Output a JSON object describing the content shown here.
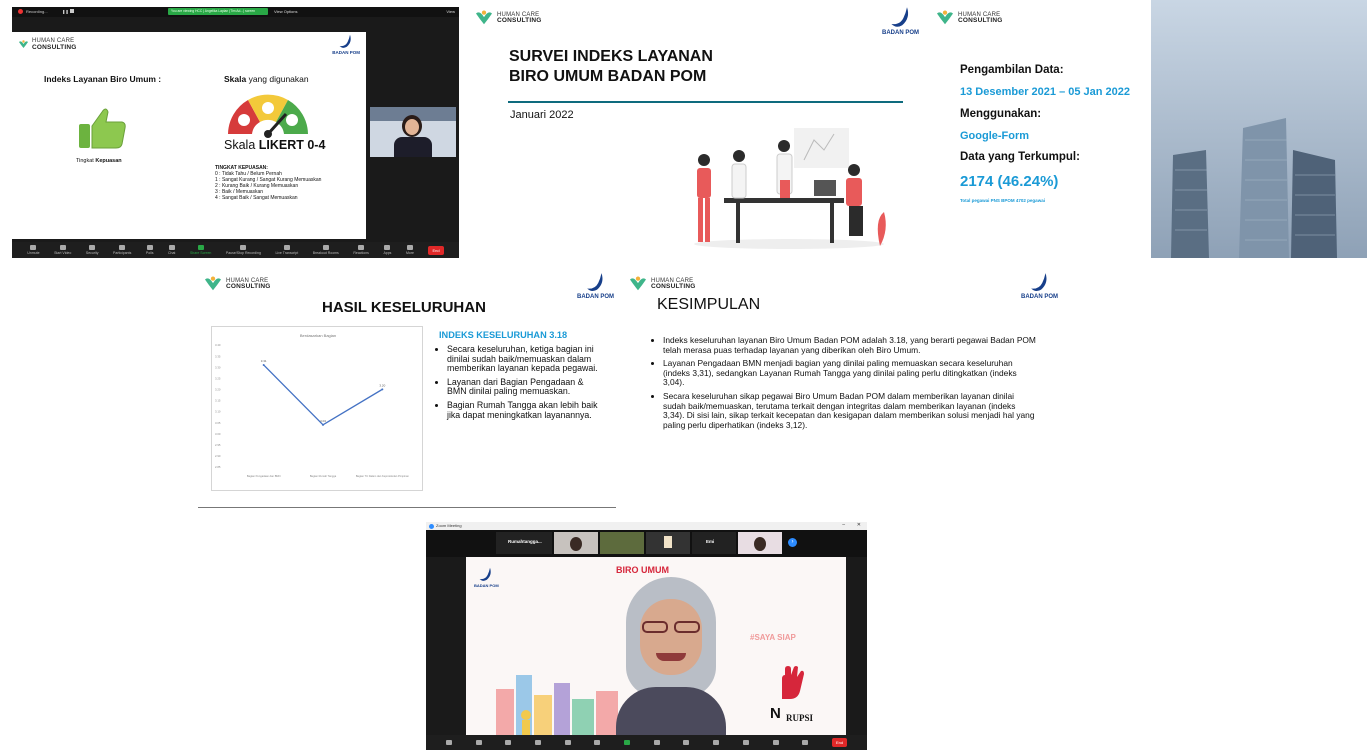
{
  "zoom1": {
    "recording": "Recording...",
    "green_banner": "You are viewing HCC | Angelika Lapian (Tim Ad...) screen",
    "view_options": "View Options",
    "view_btn": "View",
    "slide": {
      "left_title": "Indeks Layanan Biro Umum :",
      "scale_title_bold": "Skala",
      "scale_title_rest": " yang digunakan",
      "likert_prefix": "Skala ",
      "likert_bold": "LIKERT 0-4",
      "satisfaction_label_prefix": "Tingkat ",
      "satisfaction_label_bold": "Kepuasan",
      "levels_title": "TINGKAT KEPUASAN:",
      "levels": [
        "0 : Tidak Tahu / Belum Pernah",
        "1 : Sangat Kurang / Sangat Kurang Memuaskan",
        "2 : Kurang Baik / Kurang Memuaskan",
        "3 : Baik / Memuaskan",
        "4 : Sangat Baik / Sangat Memuaskan"
      ]
    },
    "toolbar": [
      "Unmute",
      "Start Video",
      "Security",
      "Participants",
      "Polls",
      "Chat",
      "Share Screen",
      "Pause/Stop Recording",
      "Live Transcript",
      "Breakout Rooms",
      "Reactions",
      "Apps",
      "More"
    ],
    "end": "End"
  },
  "brand": {
    "hcc_line1": "HUMAN CARE",
    "hcc_line2": "CONSULTING",
    "bpom": "BADAN POM"
  },
  "slide2": {
    "title_line1": "SURVEI INDEKS LAYANAN",
    "title_line2": "BIRO UMUM BADAN POM",
    "date": "Januari 2022"
  },
  "slide3": {
    "l1": "Pengambilan Data:",
    "v1": "13 Desember 2021 – 05 Jan 2022",
    "l2": "Menggunakan:",
    "v2": "Google-Form",
    "l3": "Data yang Terkumpul:",
    "v3": "2174 (46.24%)",
    "note": "Total pegawai PNS BPOM 4702 pegawai"
  },
  "slide4": {
    "title": "HASIL KESELURUHAN",
    "index_heading": "INDEKS KESELURUHAN 3.18",
    "bullets": [
      "Secara keseluruhan, ketiga bagian ini dinilai sudah baik/memuaskan dalam memberikan layanan kepada pegawai.",
      "Layanan dari Bagian Pengadaan & BMN dinilai paling memuaskan.",
      "Bagian Rumah Tangga akan lebih baik jika dapat meningkatkan layanannya."
    ]
  },
  "slide5": {
    "title": "KESIMPULAN",
    "bullets": [
      "Indeks keseluruhan layanan Biro Umum Badan POM adalah 3.18, yang berarti pegawai Badan POM telah merasa puas terhadap layanan yang diberikan oleh Biro Umum.",
      "Layanan Pengadaan BMN menjadi bagian yang dinilai paling memuaskan secara keseluruhan (indeks 3,31), sedangkan Layanan Rumah Tangga yang dinilai paling perlu ditingkatkan (indeks 3,04).",
      "Secara keseluruhan sikap pegawai Biro Umum Badan POM dalam memberikan layanan dinilai sudah baik/memuaskan, terutama terkait dengan integritas dalam memberikan layanan (indeks 3,34). Di sisi lain, sikap terkait kecepatan dan kesigapan dalam memberikan solusi menjadi hal yang paling perlu diperhatikan (indeks 3,12)."
    ]
  },
  "zoom2": {
    "window_title": "Zoom Meeting",
    "tiles": [
      "Rumahtangga...",
      "Emi"
    ],
    "banner": "BIRO UMUM",
    "saya_siap": "#SAYA SIAP",
    "korupsi": "RUPSI",
    "end": "End"
  },
  "colors": {
    "blue_accent": "#1a9ad6",
    "navy": "#173f8a",
    "teal_line": "#0e6b7e",
    "green_logo": "#3fb58a",
    "end_red": "#e02828"
  },
  "chart_data": {
    "type": "line",
    "title": "Berdasarkan Bagian",
    "categories": [
      "Bagian Pengadaan dan BMN",
      "Bagian Rumah Tangga",
      "Bagian TU Dalam dan Keprotokolan Pimpinan"
    ],
    "values": [
      3.31,
      3.04,
      3.2
    ],
    "data_labels": [
      "3.31",
      "3.04",
      "3.20"
    ],
    "yticks": [
      "3.40",
      "3.35",
      "3.30",
      "3.25",
      "3.20",
      "3.15",
      "3.10",
      "3.05",
      "3.00",
      "2.95",
      "2.90",
      "2.85"
    ],
    "ylim": [
      2.85,
      3.4
    ],
    "xlabel": "",
    "ylabel": "",
    "grid": false,
    "color": "#4472c4"
  }
}
